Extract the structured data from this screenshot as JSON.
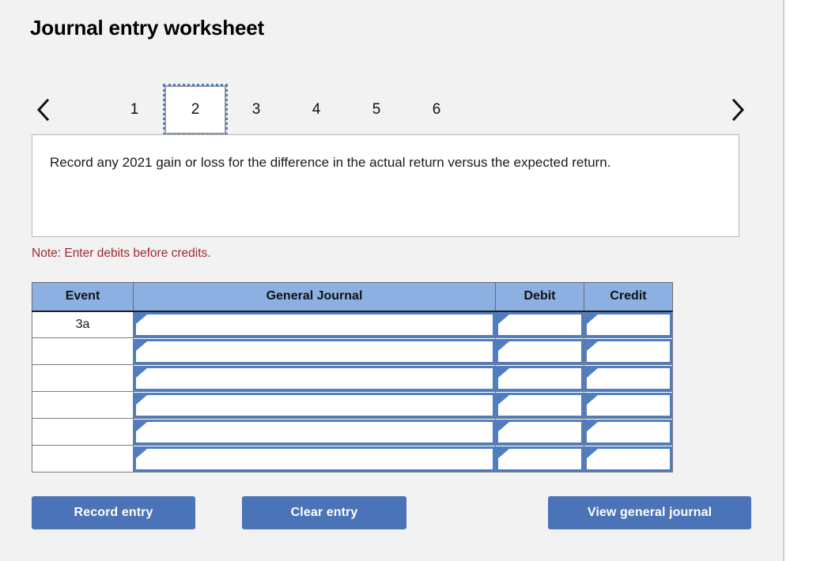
{
  "page": {
    "title": "Journal entry worksheet"
  },
  "pager": {
    "prev_icon": "chevron-left-icon",
    "next_icon": "chevron-right-icon",
    "tabs": [
      {
        "label": "1",
        "active": false
      },
      {
        "label": "2",
        "active": true
      },
      {
        "label": "3",
        "active": false
      },
      {
        "label": "4",
        "active": false
      },
      {
        "label": "5",
        "active": false
      },
      {
        "label": "6",
        "active": false
      }
    ]
  },
  "instruction": {
    "text": "Record any 2021 gain or loss for the difference in the actual return versus the expected return."
  },
  "note": {
    "text": "Note: Enter debits before credits."
  },
  "table": {
    "headers": {
      "event": "Event",
      "general_journal": "General Journal",
      "debit": "Debit",
      "credit": "Credit"
    },
    "rows": [
      {
        "event": "3a",
        "general_journal": "",
        "debit": "",
        "credit": ""
      },
      {
        "event": "",
        "general_journal": "",
        "debit": "",
        "credit": ""
      },
      {
        "event": "",
        "general_journal": "",
        "debit": "",
        "credit": ""
      },
      {
        "event": "",
        "general_journal": "",
        "debit": "",
        "credit": ""
      },
      {
        "event": "",
        "general_journal": "",
        "debit": "",
        "credit": ""
      },
      {
        "event": "",
        "general_journal": "",
        "debit": "",
        "credit": ""
      }
    ]
  },
  "buttons": {
    "record": "Record entry",
    "clear": "Clear entry",
    "view": "View general journal"
  },
  "colors": {
    "header_blue": "#8cb0e2",
    "button_blue": "#4b73b8",
    "note_red": "#9e2a2b",
    "focus_blue": "#4f7dc0",
    "page_background": "#f2f2f2"
  }
}
